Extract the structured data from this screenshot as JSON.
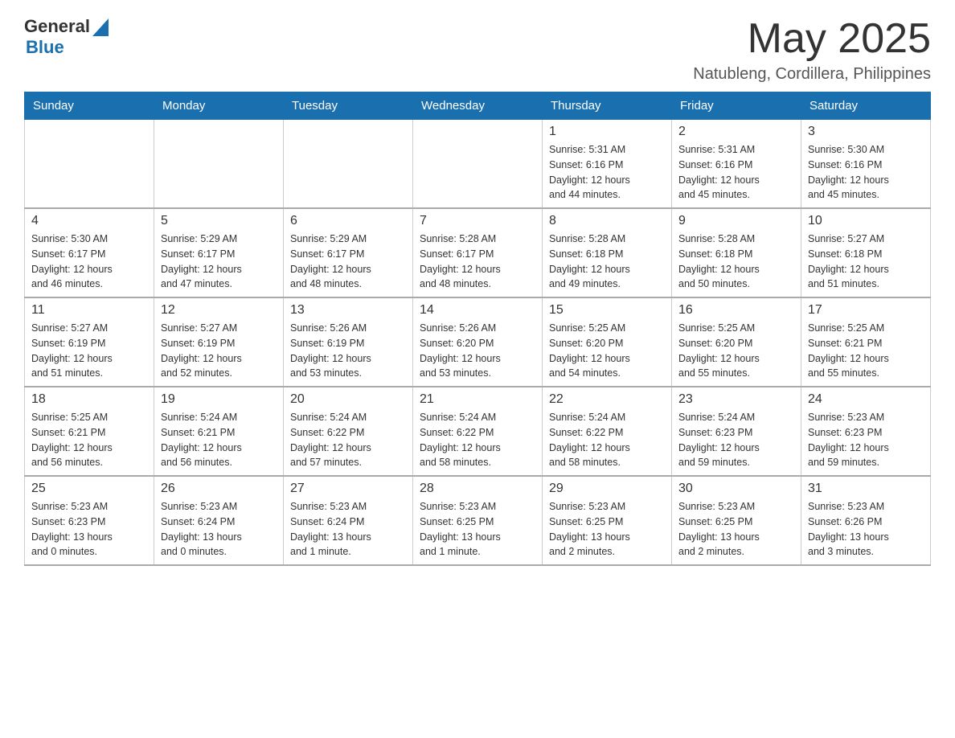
{
  "header": {
    "logo": {
      "text_general": "General",
      "text_blue": "Blue",
      "triangle_alt": "GeneralBlue logo triangle"
    },
    "title": "May 2025",
    "location": "Natubleng, Cordillera, Philippines"
  },
  "calendar": {
    "days_of_week": [
      "Sunday",
      "Monday",
      "Tuesday",
      "Wednesday",
      "Thursday",
      "Friday",
      "Saturday"
    ],
    "weeks": [
      [
        {
          "day": "",
          "info": ""
        },
        {
          "day": "",
          "info": ""
        },
        {
          "day": "",
          "info": ""
        },
        {
          "day": "",
          "info": ""
        },
        {
          "day": "1",
          "info": "Sunrise: 5:31 AM\nSunset: 6:16 PM\nDaylight: 12 hours\nand 44 minutes."
        },
        {
          "day": "2",
          "info": "Sunrise: 5:31 AM\nSunset: 6:16 PM\nDaylight: 12 hours\nand 45 minutes."
        },
        {
          "day": "3",
          "info": "Sunrise: 5:30 AM\nSunset: 6:16 PM\nDaylight: 12 hours\nand 45 minutes."
        }
      ],
      [
        {
          "day": "4",
          "info": "Sunrise: 5:30 AM\nSunset: 6:17 PM\nDaylight: 12 hours\nand 46 minutes."
        },
        {
          "day": "5",
          "info": "Sunrise: 5:29 AM\nSunset: 6:17 PM\nDaylight: 12 hours\nand 47 minutes."
        },
        {
          "day": "6",
          "info": "Sunrise: 5:29 AM\nSunset: 6:17 PM\nDaylight: 12 hours\nand 48 minutes."
        },
        {
          "day": "7",
          "info": "Sunrise: 5:28 AM\nSunset: 6:17 PM\nDaylight: 12 hours\nand 48 minutes."
        },
        {
          "day": "8",
          "info": "Sunrise: 5:28 AM\nSunset: 6:18 PM\nDaylight: 12 hours\nand 49 minutes."
        },
        {
          "day": "9",
          "info": "Sunrise: 5:28 AM\nSunset: 6:18 PM\nDaylight: 12 hours\nand 50 minutes."
        },
        {
          "day": "10",
          "info": "Sunrise: 5:27 AM\nSunset: 6:18 PM\nDaylight: 12 hours\nand 51 minutes."
        }
      ],
      [
        {
          "day": "11",
          "info": "Sunrise: 5:27 AM\nSunset: 6:19 PM\nDaylight: 12 hours\nand 51 minutes."
        },
        {
          "day": "12",
          "info": "Sunrise: 5:27 AM\nSunset: 6:19 PM\nDaylight: 12 hours\nand 52 minutes."
        },
        {
          "day": "13",
          "info": "Sunrise: 5:26 AM\nSunset: 6:19 PM\nDaylight: 12 hours\nand 53 minutes."
        },
        {
          "day": "14",
          "info": "Sunrise: 5:26 AM\nSunset: 6:20 PM\nDaylight: 12 hours\nand 53 minutes."
        },
        {
          "day": "15",
          "info": "Sunrise: 5:25 AM\nSunset: 6:20 PM\nDaylight: 12 hours\nand 54 minutes."
        },
        {
          "day": "16",
          "info": "Sunrise: 5:25 AM\nSunset: 6:20 PM\nDaylight: 12 hours\nand 55 minutes."
        },
        {
          "day": "17",
          "info": "Sunrise: 5:25 AM\nSunset: 6:21 PM\nDaylight: 12 hours\nand 55 minutes."
        }
      ],
      [
        {
          "day": "18",
          "info": "Sunrise: 5:25 AM\nSunset: 6:21 PM\nDaylight: 12 hours\nand 56 minutes."
        },
        {
          "day": "19",
          "info": "Sunrise: 5:24 AM\nSunset: 6:21 PM\nDaylight: 12 hours\nand 56 minutes."
        },
        {
          "day": "20",
          "info": "Sunrise: 5:24 AM\nSunset: 6:22 PM\nDaylight: 12 hours\nand 57 minutes."
        },
        {
          "day": "21",
          "info": "Sunrise: 5:24 AM\nSunset: 6:22 PM\nDaylight: 12 hours\nand 58 minutes."
        },
        {
          "day": "22",
          "info": "Sunrise: 5:24 AM\nSunset: 6:22 PM\nDaylight: 12 hours\nand 58 minutes."
        },
        {
          "day": "23",
          "info": "Sunrise: 5:24 AM\nSunset: 6:23 PM\nDaylight: 12 hours\nand 59 minutes."
        },
        {
          "day": "24",
          "info": "Sunrise: 5:23 AM\nSunset: 6:23 PM\nDaylight: 12 hours\nand 59 minutes."
        }
      ],
      [
        {
          "day": "25",
          "info": "Sunrise: 5:23 AM\nSunset: 6:23 PM\nDaylight: 13 hours\nand 0 minutes."
        },
        {
          "day": "26",
          "info": "Sunrise: 5:23 AM\nSunset: 6:24 PM\nDaylight: 13 hours\nand 0 minutes."
        },
        {
          "day": "27",
          "info": "Sunrise: 5:23 AM\nSunset: 6:24 PM\nDaylight: 13 hours\nand 1 minute."
        },
        {
          "day": "28",
          "info": "Sunrise: 5:23 AM\nSunset: 6:25 PM\nDaylight: 13 hours\nand 1 minute."
        },
        {
          "day": "29",
          "info": "Sunrise: 5:23 AM\nSunset: 6:25 PM\nDaylight: 13 hours\nand 2 minutes."
        },
        {
          "day": "30",
          "info": "Sunrise: 5:23 AM\nSunset: 6:25 PM\nDaylight: 13 hours\nand 2 minutes."
        },
        {
          "day": "31",
          "info": "Sunrise: 5:23 AM\nSunset: 6:26 PM\nDaylight: 13 hours\nand 3 minutes."
        }
      ]
    ]
  }
}
